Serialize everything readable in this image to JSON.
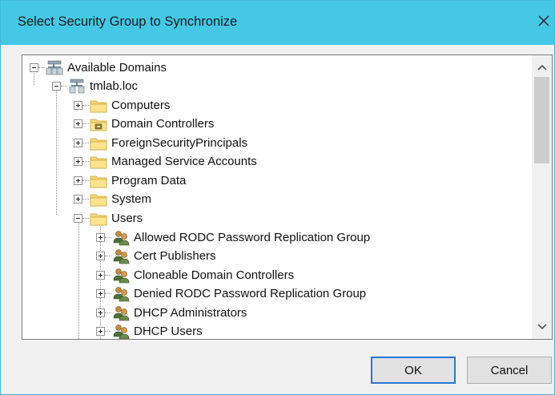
{
  "window": {
    "title": "Select Security Group to Synchronize",
    "close_glyph": "✕"
  },
  "tree": {
    "root": {
      "label": "Available Domains",
      "icon": "domains-icon"
    },
    "domain": {
      "label": "tmlab.loc",
      "icon": "domain-icon"
    },
    "containers": [
      {
        "label": "Computers",
        "icon": "folder-icon",
        "expanded": false
      },
      {
        "label": "Domain Controllers",
        "icon": "ou-folder-icon",
        "expanded": false
      },
      {
        "label": "ForeignSecurityPrincipals",
        "icon": "folder-icon",
        "expanded": false
      },
      {
        "label": "Managed Service Accounts",
        "icon": "folder-icon",
        "expanded": false
      },
      {
        "label": "Program Data",
        "icon": "folder-icon",
        "expanded": false
      },
      {
        "label": "System",
        "icon": "folder-icon",
        "expanded": false
      },
      {
        "label": "Users",
        "icon": "folder-icon",
        "expanded": true
      }
    ],
    "groups": [
      {
        "label": "Allowed RODC Password Replication Group",
        "icon": "group-icon"
      },
      {
        "label": "Cert Publishers",
        "icon": "group-icon"
      },
      {
        "label": "Cloneable Domain Controllers",
        "icon": "group-icon"
      },
      {
        "label": "Denied RODC Password Replication Group",
        "icon": "group-icon"
      },
      {
        "label": "DHCP Administrators",
        "icon": "group-icon"
      },
      {
        "label": "DHCP Users",
        "icon": "group-icon"
      }
    ]
  },
  "buttons": {
    "ok": "OK",
    "cancel": "Cancel"
  },
  "colors": {
    "titlebar": "#44c8e6",
    "dialog_bg": "#f0f0f0",
    "default_button_border": "#2d75d2"
  }
}
